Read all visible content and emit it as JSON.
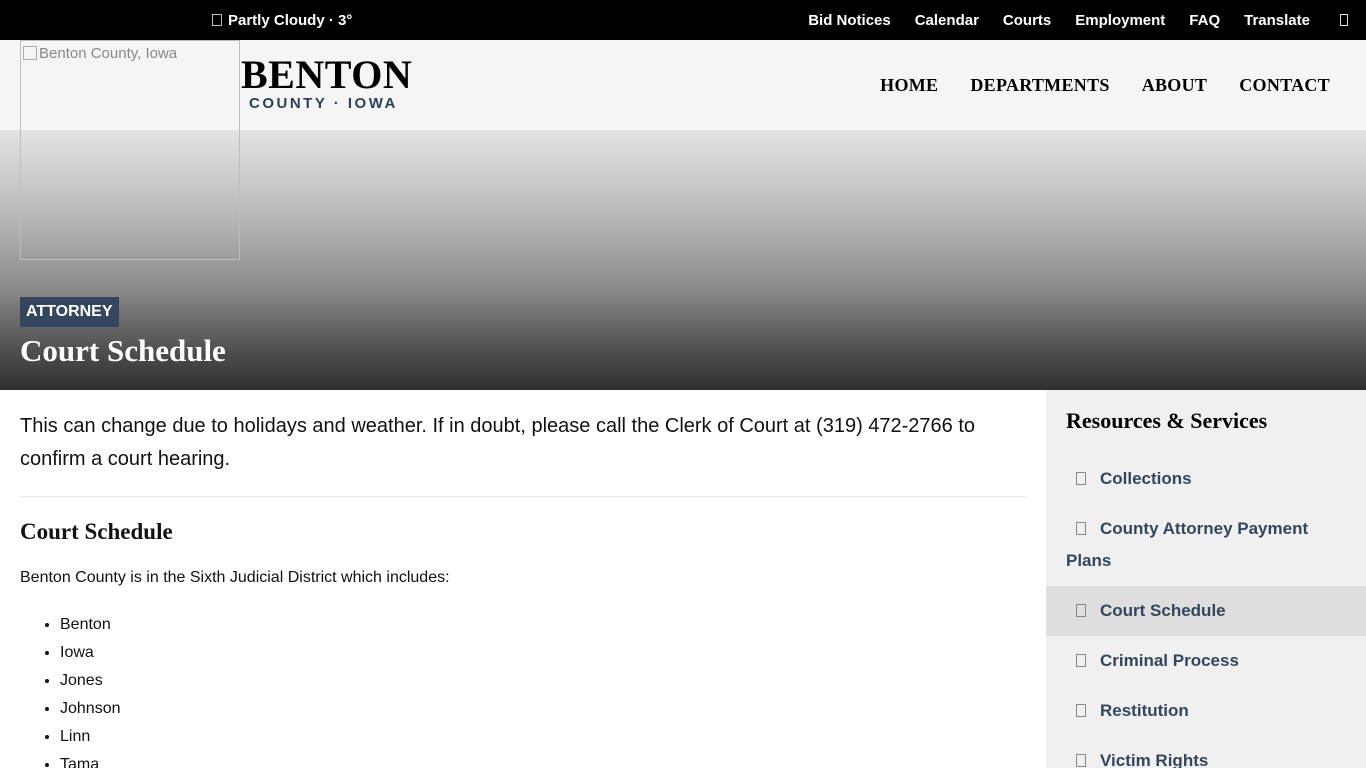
{
  "logo": {
    "alt": "Benton County, Iowa"
  },
  "weather": {
    "text": "Partly Cloudy · 3°"
  },
  "topnav": {
    "items": [
      "Bid Notices",
      "Calendar",
      "Courts",
      "Employment",
      "FAQ",
      "Translate"
    ]
  },
  "brand": {
    "name": "BENTON",
    "sub": "COUNTY · IOWA"
  },
  "mainnav": {
    "items": [
      "HOME",
      "DEPARTMENTS",
      "ABOUT",
      "CONTACT"
    ]
  },
  "hero": {
    "tag": "ATTORNEY",
    "title": "Court Schedule"
  },
  "content": {
    "intro": "This can change due to holidays and weather. If in doubt, please call the Clerk of Court at (319) 472-2766 to confirm a court hearing.",
    "section_title": "Court Schedule",
    "section_text": "Benton County is in the Sixth Judicial District which includes:",
    "counties": [
      "Benton",
      "Iowa",
      "Jones",
      "Johnson",
      "Linn",
      "Tama"
    ]
  },
  "sidebar": {
    "title": "Resources & Services",
    "items": [
      {
        "label": "Collections",
        "active": false
      },
      {
        "label": "County Attorney Payment Plans",
        "active": false
      },
      {
        "label": "Court Schedule",
        "active": true
      },
      {
        "label": "Criminal Process",
        "active": false
      },
      {
        "label": "Restitution",
        "active": false
      },
      {
        "label": "Victim Rights",
        "active": false
      }
    ]
  },
  "colors": {
    "topbar": "#000000",
    "header_bg": "#f5f5f5",
    "accent": "#34465e",
    "sidebar_bg": "#f0f0f0"
  }
}
